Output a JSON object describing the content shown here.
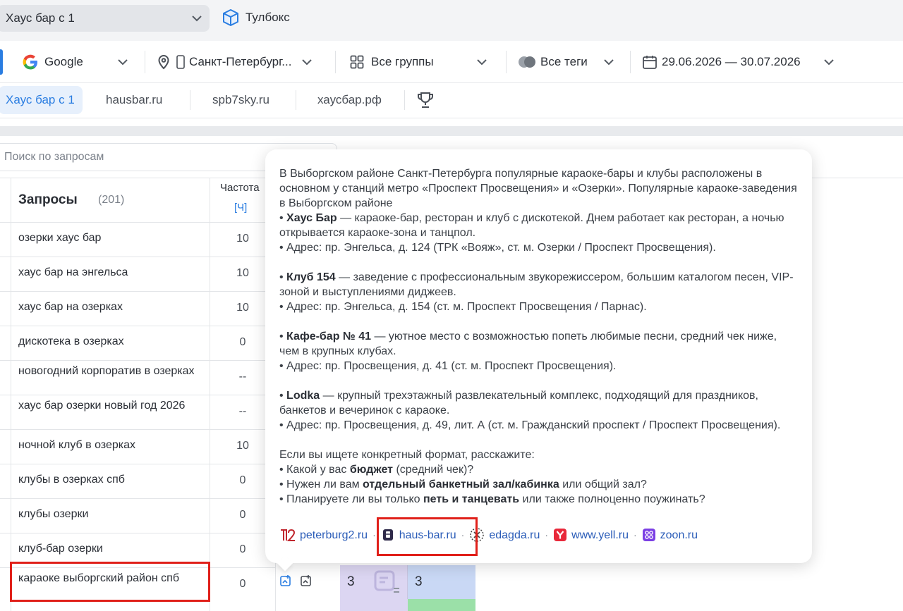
{
  "topbar": {
    "project": "Хаус бар с 1",
    "toolbox": "Тулбокс"
  },
  "filters": {
    "engine": "Google",
    "region": "Санкт-Петербург...",
    "groups": "Все группы",
    "tags": "Все теги",
    "date_range": "29.06.2026 — 30.07.2026"
  },
  "tabs": [
    "Хаус бар с 1",
    "hausbar.ru",
    "spb7sky.ru",
    "хаусбар.рф"
  ],
  "search": {
    "placeholder": "Поиск по запросам"
  },
  "table": {
    "queries_header": "Запросы",
    "queries_count": "(201)",
    "freq_header": "Частота",
    "freq_sub": "[Ч]",
    "rows": [
      {
        "query": "озерки хаус бар",
        "freq": "10"
      },
      {
        "query": "хаус бар на энгельса",
        "freq": "10"
      },
      {
        "query": "хаус бар на озерках",
        "freq": "10"
      },
      {
        "query": "дискотека в озерках",
        "freq": "0"
      },
      {
        "query": "новогодний корпоратив в озерках",
        "freq": "--"
      },
      {
        "query": "хаус бар озерки новый год 2026",
        "freq": "--"
      },
      {
        "query": "ночной клуб в озерках",
        "freq": "10"
      },
      {
        "query": "клубы в озерках спб",
        "freq": "0"
      },
      {
        "query": "клубы озерки",
        "freq": "0"
      },
      {
        "query": "клуб-бар озерки",
        "freq": "0"
      },
      {
        "query": "караоке выборгский район спб",
        "freq": "0"
      }
    ],
    "pos_a": "3",
    "pos_b": "3"
  },
  "popover": {
    "intro": "В Выборгском районе Санкт-Петербурга популярные караоке-бары и клубы расположены в основном у станций метро «Проспект Просвещения» и «Озерки». Популярные караоке-заведения в Выборгском районе",
    "v1_name": "Хаус Бар",
    "v1_desc": " — караоке-бар, ресторан и клуб с дискотекой. Днем работает как ресторан, а ночью открывается караоке-зона и танцпол.",
    "v1_addr": "• Адрес: пр. Энгельса, д. 124 (ТРК «Вояж», ст. м. Озерки / Проспект Просвещения).",
    "v2_name": "Клуб 154",
    "v2_desc": " — заведение с профессиональным звукорежиссером, большим каталогом песен, VIP-зоной и выступлениями диджеев.",
    "v2_addr": "• Адрес: пр. Энгельса, д. 154 (ст. м. Проспект Просвещения / Парнас).",
    "v3_name": "Кафе-бар № 41",
    "v3_desc": " — уютное место с возможностью попеть любимые песни, средний чек ниже, чем в крупных клубах.",
    "v3_addr": "• Адрес: пр. Просвещения, д. 41 (ст. м. Проспект Просвещения).",
    "v4_name": "Lodka",
    "v4_desc": " — крупный трехэтажный развлекательный комплекс, подходящий для праздников, банкетов и вечеринок с караоке.",
    "v4_addr": "• Адрес: пр. Просвещения, д. 49, лит. А (ст. м. Гражданский проспект / Проспект Просвещения).",
    "ask_intro": "Если вы ищете конкретный формат, расскажите:",
    "q1_pre": "• Какой у вас ",
    "q1_bold": "бюджет",
    "q1_post": " (средний чек)?",
    "q2_pre": "• Нужен ли вам ",
    "q2_bold": "отдельный банкетный зал/кабинка",
    "q2_post": " или общий зал?",
    "q3_pre": "• Планируете ли вы только ",
    "q3_bold": "петь и танцевать",
    "q3_post": " или также полноценно поужинать?",
    "sources": [
      "peterburg2.ru",
      "haus-bar.ru",
      "edagda.ru",
      "www.yell.ru",
      "zoon.ru"
    ]
  },
  "colors": {
    "accent": "#2a7de1",
    "highlight_box": "#e0201a",
    "pos_cell_bg": "#dcd6f2",
    "pos_cell_bg2": "#c9d8f5",
    "pos_green": "#9be0a8"
  }
}
